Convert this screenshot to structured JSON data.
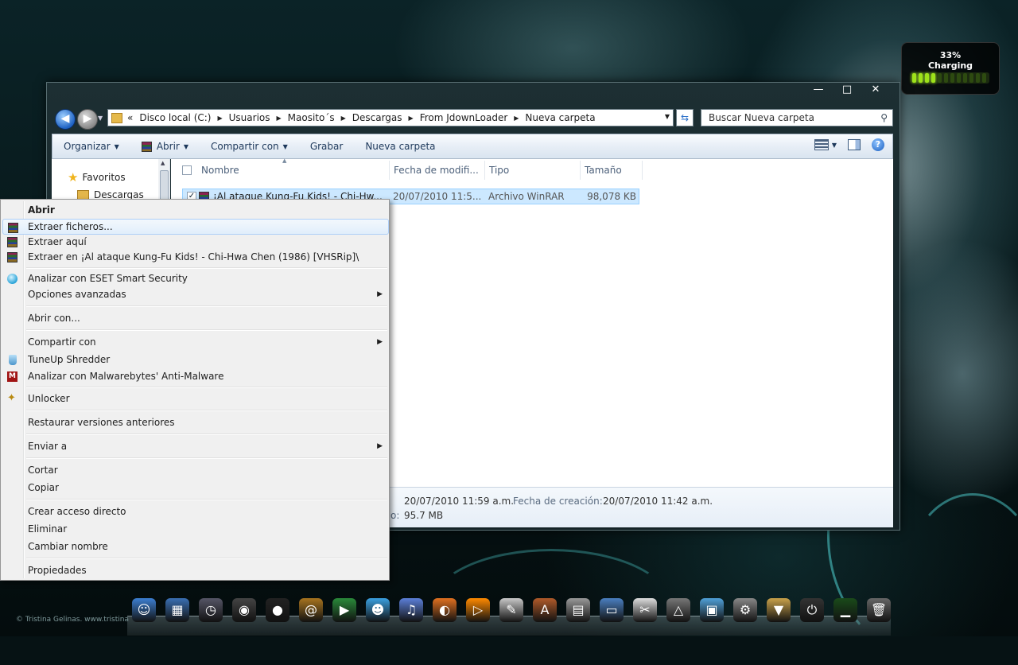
{
  "wallpaper": {
    "copyright": "© Tristina Gelinas. www.tristina"
  },
  "battery": {
    "percent": "33%",
    "status": "Charging",
    "level": 0.33
  },
  "window": {
    "caption": {
      "minimize": "—",
      "maximize": "□",
      "close": "✕"
    },
    "address": {
      "overflow": "«",
      "crumbs": [
        "Disco local (C:)",
        "Usuarios",
        "Maosito´s",
        "Descargas",
        "From JdownLoader",
        "Nueva carpeta"
      ]
    },
    "search_placeholder": "Buscar Nueva carpeta",
    "toolbar": {
      "organize": "Organizar",
      "open": "Abrir",
      "share": "Compartir con",
      "burn": "Grabar",
      "new_folder": "Nueva carpeta"
    },
    "navpane": {
      "favorites": "Favoritos",
      "downloads": "Descargas"
    },
    "columns": {
      "name": "Nombre",
      "modified": "Fecha de modifi...",
      "type": "Tipo",
      "size": "Tamaño"
    },
    "file": {
      "name": "¡Al ataque Kung-Fu Kids! - Chi-Hw...",
      "modified": "20/07/2010 11:5...",
      "type": "Archivo WinRAR",
      "size": "98,078 KB"
    },
    "details": {
      "modified_value": "20/07/2010 11:59 a.m.",
      "created_label": "Fecha de creación:",
      "created_value": "20/07/2010 11:42 a.m.",
      "size_prefix": "o:",
      "size_value": "95.7 MB"
    }
  },
  "context_menu": {
    "open": "Abrir",
    "extract_files": "Extraer ficheros...",
    "extract_here": "Extraer aquí",
    "extract_to": "Extraer en ¡Al ataque Kung-Fu Kids! - Chi-Hwa Chen (1986) [VHSRip]\\",
    "eset_scan": "Analizar con ESET Smart Security",
    "advanced": "Opciones avanzadas",
    "open_with": "Abrir con...",
    "share_with": "Compartir con",
    "shredder": "TuneUp Shredder",
    "malwarebytes": "Analizar con Malwarebytes' Anti-Malware",
    "unlocker": "Unlocker",
    "restore": "Restaurar versiones anteriores",
    "send_to": "Enviar a",
    "cut": "Cortar",
    "copy": "Copiar",
    "create_shortcut": "Crear acceso directo",
    "delete": "Eliminar",
    "rename": "Cambiar nombre",
    "properties": "Propiedades"
  },
  "dock": {
    "icons": [
      "finder-icon",
      "dashboard-icon",
      "time-machine-icon",
      "disk-icon",
      "alien-icon",
      "address-book-icon",
      "media-play-icon",
      "messenger-icon",
      "itunes-icon",
      "firefox-icon",
      "vlc-icon",
      "notes-icon",
      "applications-icon",
      "calculator-icon",
      "documents-folder-icon",
      "tools-icon",
      "hanger-icon",
      "network-icon",
      "settings-icon",
      "downloads-box-icon",
      "power-icon",
      "activity-monitor-icon",
      "trash-icon"
    ]
  }
}
